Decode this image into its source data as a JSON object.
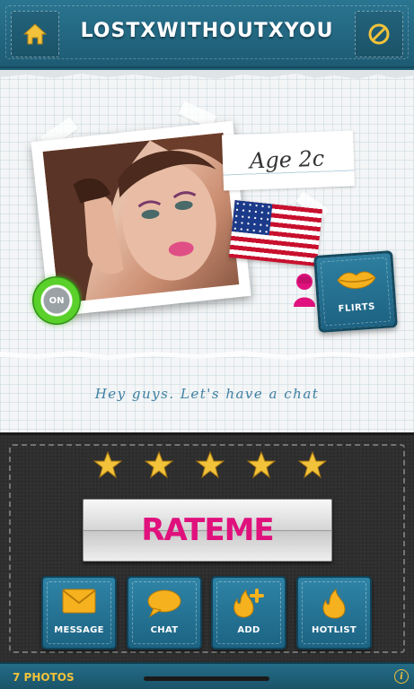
{
  "header": {
    "title": "LOSTXWITHOUTXYOU",
    "home_icon": "home-icon",
    "block_icon": "block-icon"
  },
  "profile": {
    "age_text": "Age 2c",
    "online_label": "ON",
    "country_flag": "us-flag-icon",
    "status_message": "Hey guys.  Let's have a chat",
    "flirts_label": "FLIRTS"
  },
  "rating": {
    "stars": 5,
    "star_color": "#f2c23a",
    "button_label": "RATEME",
    "button_color": "#e0117d"
  },
  "actions": [
    {
      "label": "MESSAGE",
      "icon": "envelope-icon"
    },
    {
      "label": "CHAT",
      "icon": "chat-bubble-icon"
    },
    {
      "label": "ADD",
      "icon": "flame-plus-icon"
    },
    {
      "label": "HOTLIST",
      "icon": "flame-icon"
    }
  ],
  "footer": {
    "photos_label": "7 PHOTOS",
    "info_icon": "info-icon"
  },
  "colors": {
    "header": "#1f6480",
    "accent": "#f2c23a",
    "pink": "#e0117d"
  }
}
